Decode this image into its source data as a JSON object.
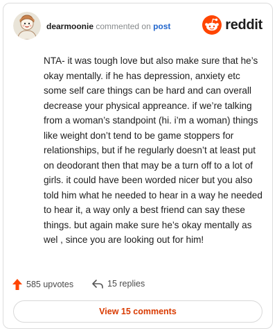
{
  "comment": {
    "username": "dearmoonie",
    "action_text": "commented on",
    "post_link": "post",
    "brand": "reddit",
    "body": "NTA- it was tough love but also make sure that he’s okay mentally. if he has depression, anxiety etc some self care things can be hard and can overall decrease your physical appreance. if we’re talking from a woman’s standpoint (hi. i’m a woman) things like weight don’t tend to be game stoppers for relationships, but if he regularly doesn’t at least put on deodorant then that may be a turn off to a lot of girls. it could have been worded nicer but you also told him what he needed to hear in a way he needed to hear it, a way only a best friend can say these things. but again make sure he’s okay mentally as wel , since you are looking out for him!"
  },
  "footer": {
    "upvotes": "585 upvotes",
    "replies": "15 replies",
    "view_comments": "View 15 comments"
  },
  "colors": {
    "accent": "#ff4500",
    "link": "#2266cc",
    "button_text": "#d93a00"
  },
  "icons": {
    "avatar": "avatar-icon",
    "brand": "reddit-logo-icon",
    "upvote": "upvote-arrow-icon",
    "reply": "reply-arrow-icon"
  }
}
